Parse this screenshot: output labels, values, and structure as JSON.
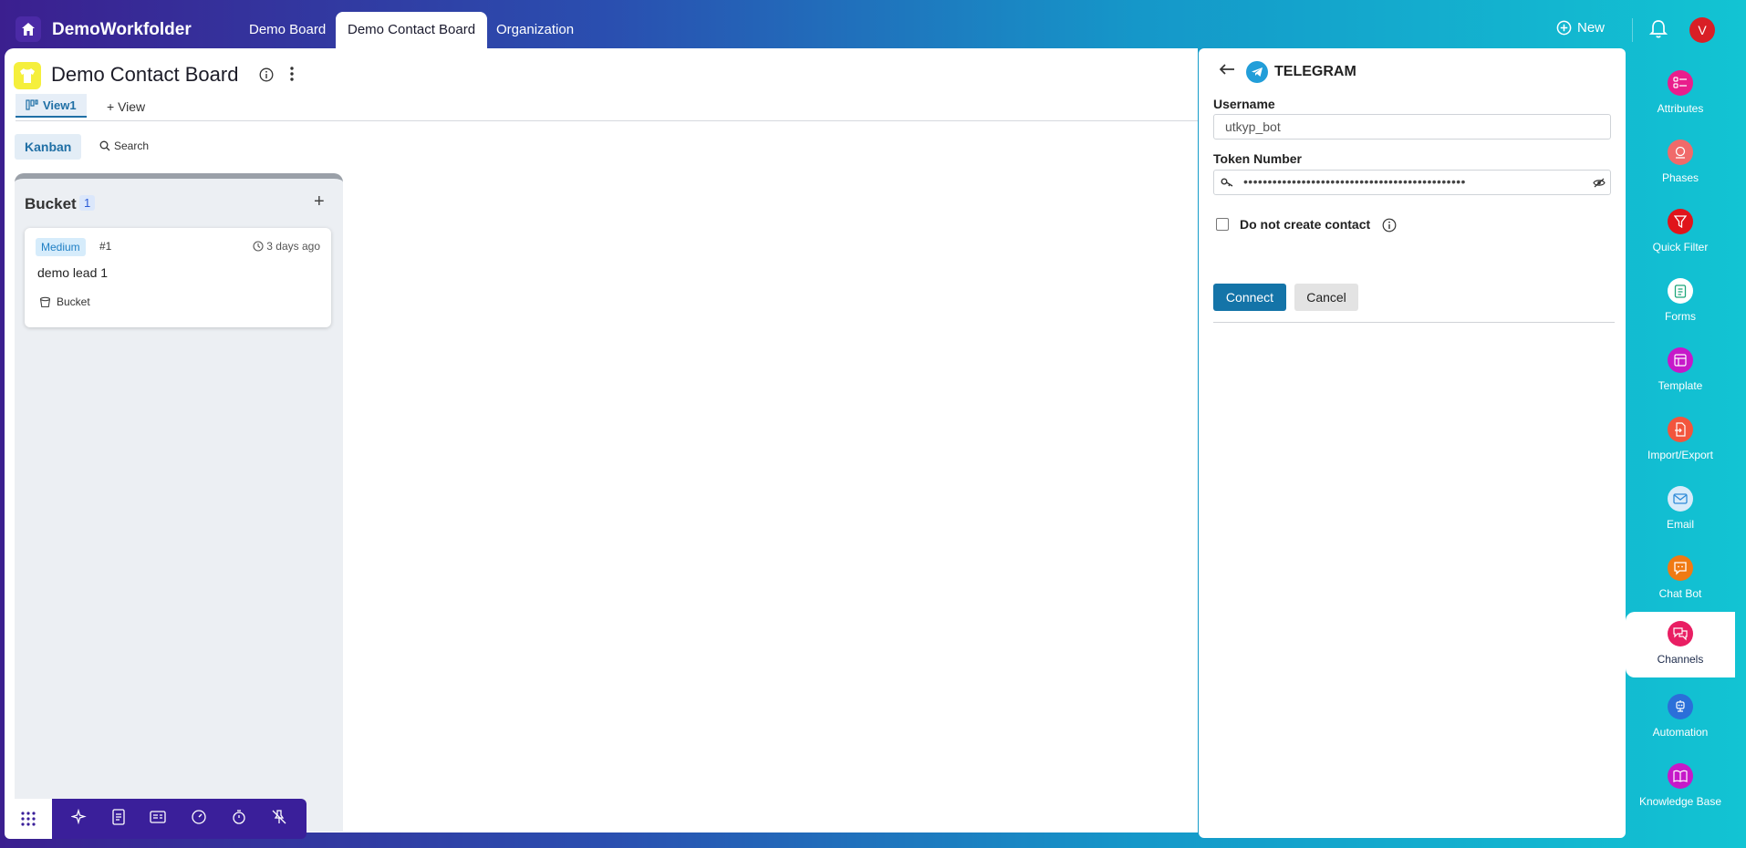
{
  "topbar": {
    "app_name": "DemoWorkfolder",
    "tabs": [
      {
        "label": "Demo Board"
      },
      {
        "label": "Demo Contact Board"
      },
      {
        "label": "Organization"
      }
    ],
    "new_label": "New",
    "avatar_initial": "V"
  },
  "board": {
    "title": "Demo Contact Board",
    "view_tab": "View1",
    "add_view": "View",
    "kanban_label": "Kanban",
    "search_label": "Search"
  },
  "column": {
    "title": "Bucket",
    "count": "1",
    "card": {
      "priority": "Medium",
      "id": "#1",
      "time": "3 days ago",
      "title": "demo lead 1",
      "bucket": "Bucket"
    }
  },
  "panel": {
    "title": "TELEGRAM",
    "username_label": "Username",
    "username_value": "utkyp_bot",
    "token_label": "Token Number",
    "token_masked": "••••••••••••••••••••••••••••••••••••••••••••••",
    "checkbox_label": "Do not create contact",
    "connect_label": "Connect",
    "cancel_label": "Cancel"
  },
  "rail": [
    {
      "label": "Attributes",
      "color": "#e91e8c"
    },
    {
      "label": "Phases",
      "color": "#f06a6a"
    },
    {
      "label": "Quick Filter",
      "color": "#e0151b"
    },
    {
      "label": "Forms",
      "color": "#1fa77a"
    },
    {
      "label": "Template",
      "color": "#c619c9"
    },
    {
      "label": "Import/Export",
      "color": "#f2553d"
    },
    {
      "label": "Email",
      "color": "#2e8ad8"
    },
    {
      "label": "Chat Bot",
      "color": "#f07a14"
    },
    {
      "label": "Channels",
      "color": "#e91e63"
    },
    {
      "label": "Automation",
      "color": "#2b6fd9"
    },
    {
      "label": "Knowledge Base",
      "color": "#c619c9"
    }
  ],
  "colors": {
    "accent": "#1474a8",
    "header_gradient_start": "#3b1f8f",
    "header_gradient_end": "#12c4d3"
  }
}
